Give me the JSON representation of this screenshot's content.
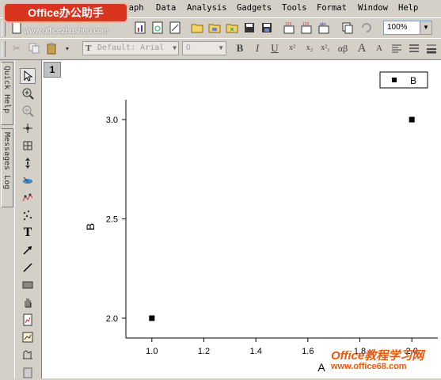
{
  "menu": {
    "items": [
      "Graph",
      "Data",
      "Analysis",
      "Gadgets",
      "Tools",
      "Format",
      "Window",
      "Help"
    ]
  },
  "watermarks": {
    "top_logo": "Office办公助手",
    "top_url": "www.officezhushou.com",
    "bottom_logo": "Office教程学习网",
    "bottom_url": "www.office68.com"
  },
  "toolbar": {
    "zoom_value": "100%",
    "font_name": "Default: Arial",
    "font_size": "0",
    "format_buttons": [
      "B",
      "I",
      "U",
      "x²",
      "x₂",
      "x²₁",
      "αβ",
      "A",
      "A"
    ]
  },
  "sidetabs": {
    "quick_help": "Quick Help",
    "messages_log": "Messages Log"
  },
  "graph": {
    "layer_label": "1"
  },
  "chart_data": {
    "type": "scatter",
    "series": [
      {
        "name": "B",
        "x": [
          1.0,
          2.0
        ],
        "y": [
          2.0,
          3.0
        ],
        "marker": "square",
        "color": "#000000"
      }
    ],
    "xlabel": "A",
    "ylabel": "B",
    "xlim": [
      0.9,
      2.1
    ],
    "ylim": [
      1.9,
      3.1
    ],
    "xticks": [
      1.0,
      1.2,
      1.4,
      1.6,
      1.8,
      2.0
    ],
    "xtick_labels": [
      "1.0",
      "1.2",
      "1.4",
      "1.6",
      "1.8",
      "2.0"
    ],
    "yticks": [
      2.0,
      2.5,
      3.0
    ],
    "ytick_labels": [
      "2.0",
      "2.5",
      "3.0"
    ],
    "legend": {
      "position": "top-right",
      "entries": [
        "B"
      ]
    },
    "grid": false
  },
  "colors": {
    "chrome": "#d4d0c8",
    "canvas": "#ffffff",
    "watermark_red": "#d8341e",
    "watermark_orange": "#e8590c"
  }
}
